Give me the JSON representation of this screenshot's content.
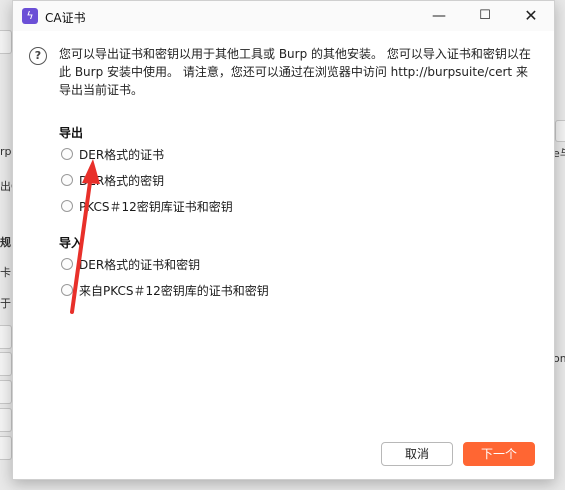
{
  "background": {
    "fragments": [
      "rp",
      "出C",
      "规",
      "卡",
      "于l",
      "om",
      "e与"
    ]
  },
  "dialog": {
    "title": "CA证书",
    "app_icon": "lightning-icon",
    "window_controls": {
      "minimize": "—",
      "maximize": "☐",
      "close": "✕"
    },
    "intro": "您可以导出证书和密钥以用于其他工具或 Burp 的其他安装。 您可以导入证书和密钥以在此 Burp 安装中使用。 请注意，您还可以通过在浏览器中访问 http://burpsuite/cert 来导出当前证书。",
    "export": {
      "title": "导出",
      "options": [
        "DER格式的证书",
        "DER格式的密钥",
        "PKCS＃12密钥库证书和密钥"
      ]
    },
    "import": {
      "title": "导入",
      "options": [
        "DER格式的证书和密钥",
        "来自PKCS＃12密钥库的证书和密钥"
      ]
    },
    "buttons": {
      "cancel": "取消",
      "next": "下一个"
    },
    "colors": {
      "accent": "#ff6633",
      "annotation_arrow": "#e8302a"
    }
  }
}
